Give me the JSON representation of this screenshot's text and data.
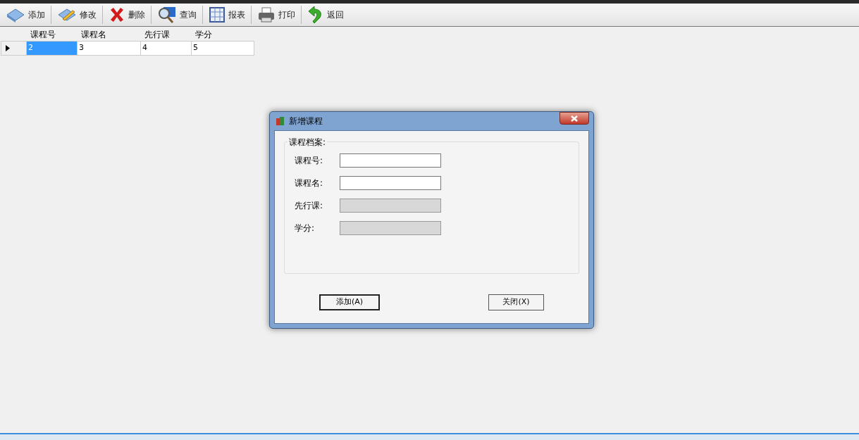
{
  "toolbar": [
    {
      "kind": "add",
      "label": "添加"
    },
    {
      "kind": "edit",
      "label": "修改"
    },
    {
      "kind": "delete",
      "label": "删除"
    },
    {
      "kind": "search",
      "label": "查询"
    },
    {
      "kind": "report",
      "label": "报表"
    },
    {
      "kind": "print",
      "label": "打印"
    },
    {
      "kind": "back",
      "label": "返回"
    }
  ],
  "table": {
    "columns": [
      "课程号",
      "课程名",
      "先行课",
      "学分"
    ],
    "rows": [
      {
        "current": true,
        "cells": [
          {
            "text": "2",
            "selected": true
          },
          {
            "text": "3",
            "selected": false
          },
          {
            "text": "4",
            "selected": false
          },
          {
            "text": "5",
            "selected": false
          }
        ]
      }
    ]
  },
  "dialog": {
    "title": "新增课程",
    "group_title": "课程档案:",
    "fields": [
      {
        "label": "课程号:",
        "disabled": false
      },
      {
        "label": "课程名:",
        "disabled": false
      },
      {
        "label": "先行课:",
        "disabled": true
      },
      {
        "label": "学分:",
        "disabled": true
      }
    ],
    "buttons": [
      {
        "label": "添加(A)",
        "default": true
      },
      {
        "label": "关闭(X)",
        "default": false
      }
    ]
  }
}
